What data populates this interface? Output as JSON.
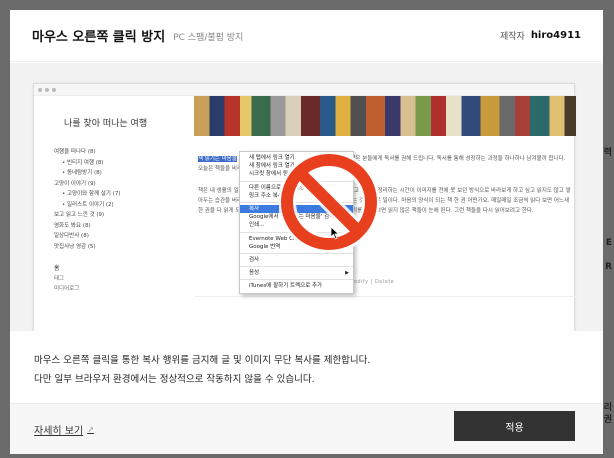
{
  "modal": {
    "title": "마우스 오른쪽 클릭 방지",
    "subtitle": "PC 스팸/불펌 방지",
    "author_label": "제작자",
    "author_name": "hiro4911"
  },
  "preview": {
    "blog_title": "나를 찾아 떠나는 여행",
    "categories": [
      {
        "label": "여행을 떠나다 (8)",
        "sub": false
      },
      {
        "label": "• 빈티지 여행 (8)",
        "sub": true
      },
      {
        "label": "• 동네탐방기 (8)",
        "sub": true
      },
      {
        "label": "고양이 이야기 (9)",
        "sub": false
      },
      {
        "label": "• 고양이와 함께 살기 (7)",
        "sub": true
      },
      {
        "label": "• 일러스트 이야기 (2)",
        "sub": true
      },
      {
        "label": "보고 읽고 느낀 것 (9)",
        "sub": false
      },
      {
        "label": "영화도 봐요 (8)",
        "sub": false
      },
      {
        "label": "일상다반사 (8)",
        "sub": false
      },
      {
        "label": "맛집사냥 영감 (5)",
        "sub": false
      }
    ],
    "side_heading": "홈",
    "side_links": [
      "태그",
      "미디어로그"
    ],
    "para1_highlight": "책 읽기는 마음을",
    "para1_rest": " 여러가지 생각을 정리하고 자기만의 생각을 갖고 싶은 분들에게 독서를 권해 드립니다. 독서를 통해 성장하는 과정을 하나하나 남겨볼까 합니다. 오늘은 책들을 비추기로 결심했다.",
    "para2": "책은 내 생활의 일부가 되어 버렸다. 무언가를 하는 사이사이 책을 읽고 생각을 정리하는 시간이 이미지를 전에 못 보던 방식으로 바라보게 하고 싶고 읽지도 않고 쌓아두는 습관을 버리고 싶다. 다양한 종류의 책을 읽으며 시간을 보내는 것은 좋은 일이다. 마음의 양식이 되는 책 한 권 어떤가요. 매일매일 조금씩 읽다 보면 어느새 한 권을 다 읽게 되고 그렇게 쌓인 책들이 나를 만들어 준다. 책장 정리를 하다 보면 읽지 않은 책들이 눈에 띈다. 그런 책들을 다시 읽어보려고 한다.",
    "modify_text": "Modify  |  Delete",
    "context_menu": [
      {
        "label": "새 탭에서 링크 열기",
        "type": "item"
      },
      {
        "label": "새 창에서 링크 열기",
        "type": "item"
      },
      {
        "label": "시크릿 창에서 링크 열기",
        "type": "item"
      },
      {
        "label": "",
        "type": "sep"
      },
      {
        "label": "다른 이름으로 링크 저장...",
        "type": "item"
      },
      {
        "label": "링크 주소 복사",
        "type": "item"
      },
      {
        "label": "",
        "type": "sep"
      },
      {
        "label": "복사",
        "type": "active"
      },
      {
        "label": "Google에서 '책 읽기는 마음을' 검색",
        "type": "item"
      },
      {
        "label": "인쇄...",
        "type": "item"
      },
      {
        "label": "",
        "type": "sep"
      },
      {
        "label": "Evernote Web Clipper",
        "type": "sub"
      },
      {
        "label": "Google 번역",
        "type": "item"
      },
      {
        "label": "",
        "type": "sep"
      },
      {
        "label": "검사",
        "type": "item"
      },
      {
        "label": "",
        "type": "sep"
      },
      {
        "label": "음성",
        "type": "sub"
      },
      {
        "label": "",
        "type": "sep"
      },
      {
        "label": "iTunes에 팔하기 트랙으로 추가",
        "type": "item"
      }
    ]
  },
  "description": {
    "line1": "마우스 오른쪽 클릭을 통한 복사 행위를 금지해 글 및 이미지 무단 복사를 제한합니다.",
    "line2": "다만 일부 브라우저 환경에서는 정상적으로 작동하지 않을 수 있습니다."
  },
  "footer": {
    "more_link": "자세히 보기",
    "apply_label": "적용"
  },
  "backdrop": {
    "edge_texts": [
      "력",
      "E",
      "R",
      "리",
      "권"
    ]
  }
}
